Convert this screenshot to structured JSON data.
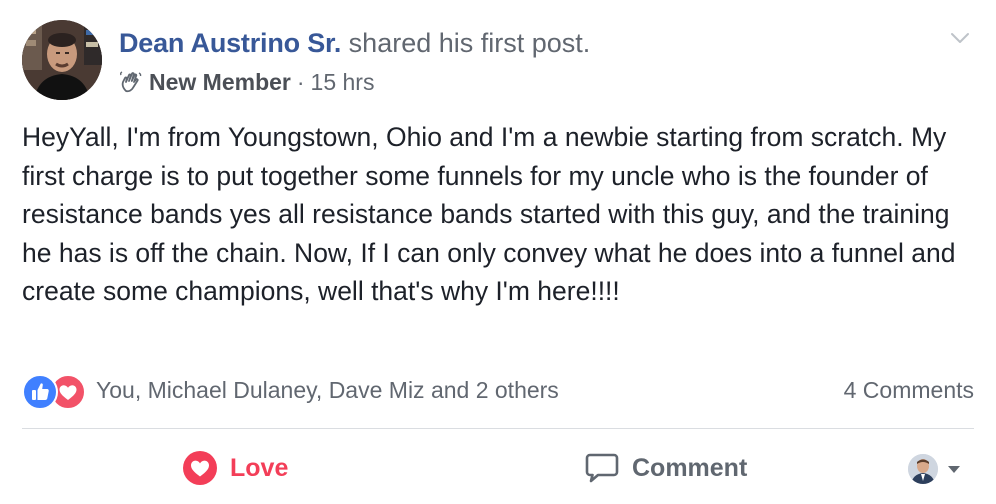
{
  "post": {
    "author": "Dean Austrino Sr.",
    "action": "shared his first post.",
    "badge": {
      "icon": "waving-hand-icon",
      "label": "New Member"
    },
    "separator": "·",
    "time": "15 hrs",
    "body": "HeyYall, I'm from Youngstown, Ohio and I'm a newbie starting from scratch. My first charge is to put together some funnels for my uncle who is the founder of resistance bands yes all resistance bands started with this guy, and the training he has is off the chain. Now, If I can only convey what he does into a funnel and create some champions, well that's why I'm here!!!!"
  },
  "reactions": {
    "types": [
      "like-icon",
      "love-icon"
    ],
    "names": "You, Michael Dulaney, Dave Miz and 2 others",
    "comments": "4 Comments"
  },
  "actions": {
    "love_label": "Love",
    "comment_label": "Comment"
  },
  "colors": {
    "author_link": "#385898",
    "secondary_text": "#616770",
    "body_text": "#1d2129",
    "like_blue": "#4080ff",
    "love_red": "#f33e58",
    "divider": "#dadde1"
  }
}
